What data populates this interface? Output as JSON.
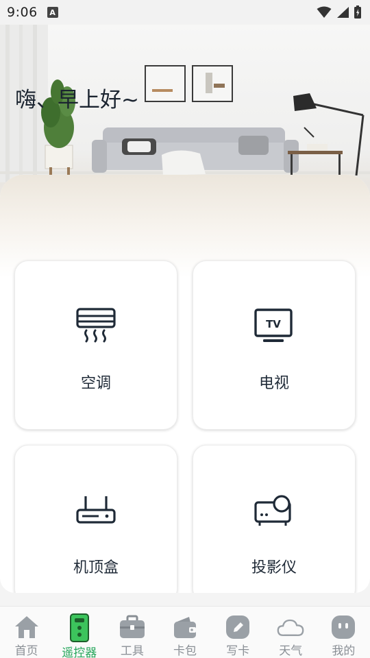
{
  "status_bar": {
    "time": "9:06",
    "indicator": "A"
  },
  "hero": {
    "greeting": "嗨、早上好~"
  },
  "devices": [
    {
      "label": "空调",
      "icon": "air-conditioner-icon"
    },
    {
      "label": "电视",
      "icon": "tv-icon"
    },
    {
      "label": "机顶盒",
      "icon": "set-top-box-icon"
    },
    {
      "label": "投影仪",
      "icon": "projector-icon"
    }
  ],
  "tv_icon_text": "TV",
  "nav": {
    "active_color": "#26a65b",
    "items": [
      {
        "label": "首页",
        "icon": "home-icon"
      },
      {
        "label": "遥控器",
        "icon": "remote-icon"
      },
      {
        "label": "工具",
        "icon": "toolbox-icon"
      },
      {
        "label": "卡包",
        "icon": "wallet-icon"
      },
      {
        "label": "写卡",
        "icon": "pen-icon"
      },
      {
        "label": "天气",
        "icon": "cloud-icon"
      },
      {
        "label": "我的",
        "icon": "profile-icon"
      }
    ]
  }
}
